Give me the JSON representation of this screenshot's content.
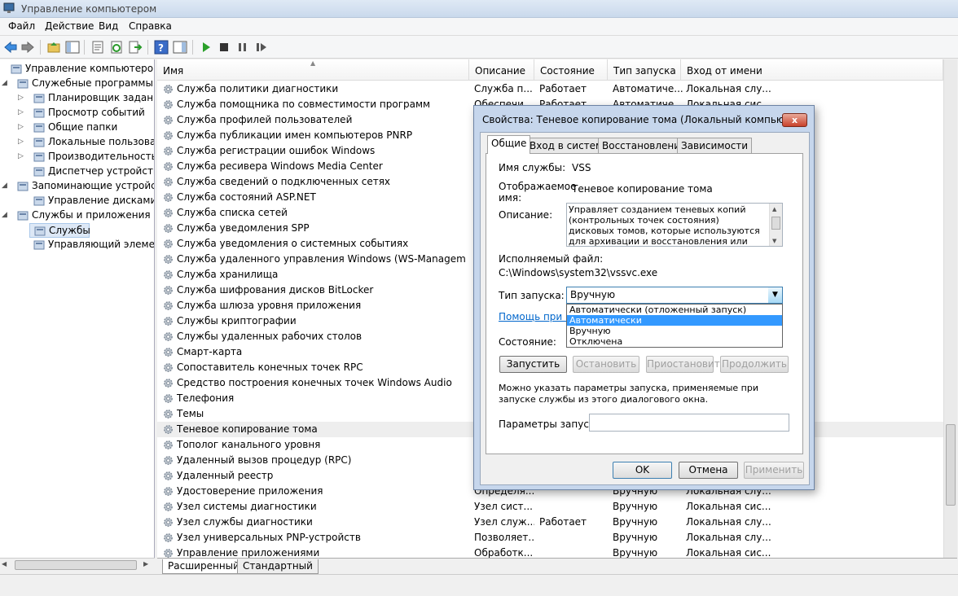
{
  "window": {
    "title": "Управление компьютером"
  },
  "menu": [
    "Файл",
    "Действие",
    "Вид",
    "Справка"
  ],
  "tree": {
    "items": [
      {
        "label": "Управление компьютером (л",
        "indent": 0,
        "arrow": ""
      },
      {
        "label": "Служебные программы",
        "indent": 1,
        "arrow": "◢"
      },
      {
        "label": "Планировщик заданий",
        "indent": 2,
        "arrow": "▷"
      },
      {
        "label": "Просмотр событий",
        "indent": 2,
        "arrow": "▷"
      },
      {
        "label": "Общие папки",
        "indent": 2,
        "arrow": "▷"
      },
      {
        "label": "Локальные пользовате",
        "indent": 2,
        "arrow": "▷"
      },
      {
        "label": "Производительность",
        "indent": 2,
        "arrow": "▷"
      },
      {
        "label": "Диспетчер устройств",
        "indent": 2,
        "arrow": ""
      },
      {
        "label": "Запоминающие устройст",
        "indent": 1,
        "arrow": "◢"
      },
      {
        "label": "Управление дисками",
        "indent": 2,
        "arrow": ""
      },
      {
        "label": "Службы и приложения",
        "indent": 1,
        "arrow": "◢"
      },
      {
        "label": "Службы",
        "indent": 2,
        "arrow": "",
        "selected": true
      },
      {
        "label": "Управляющий элемен",
        "indent": 2,
        "arrow": ""
      }
    ]
  },
  "list": {
    "columns": [
      "Имя",
      "Описание",
      "Состояние",
      "Тип запуска",
      "Вход от имени"
    ],
    "rows": [
      [
        "Служба политики диагностики",
        "Служба п...",
        "Работает",
        "Автоматиче...",
        "Локальная слу..."
      ],
      [
        "Служба помощника по совместимости программ",
        "Обеспечи...",
        "Работает",
        "Автоматиче...",
        "Локальная сис..."
      ],
      [
        "Служба профилей пользователей",
        "",
        "",
        "",
        ""
      ],
      [
        "Служба публикации имен компьютеров PNRP",
        "",
        "",
        "",
        ""
      ],
      [
        "Служба регистрации ошибок Windows",
        "",
        "",
        "",
        ""
      ],
      [
        "Служба ресивера Windows Media Center",
        "",
        "",
        "",
        ""
      ],
      [
        "Служба сведений о подключенных сетях",
        "",
        "",
        "",
        ""
      ],
      [
        "Служба состояний ASP.NET",
        "",
        "",
        "",
        ""
      ],
      [
        "Служба списка сетей",
        "",
        "",
        "",
        ""
      ],
      [
        "Служба уведомления SPP",
        "",
        "",
        "",
        ""
      ],
      [
        "Служба уведомления о системных событиях",
        "",
        "",
        "",
        ""
      ],
      [
        "Служба удаленного управления Windows (WS-Management)",
        "",
        "",
        "",
        ""
      ],
      [
        "Служба хранилища",
        "",
        "",
        "",
        ""
      ],
      [
        "Служба шифрования дисков BitLocker",
        "",
        "",
        "",
        ""
      ],
      [
        "Служба шлюза уровня приложения",
        "",
        "",
        "",
        ""
      ],
      [
        "Службы криптографии",
        "",
        "",
        "",
        ""
      ],
      [
        "Службы удаленных рабочих столов",
        "",
        "",
        "",
        ""
      ],
      [
        "Смарт-карта",
        "",
        "",
        "",
        ""
      ],
      [
        "Сопоставитель конечных точек RPC",
        "",
        "",
        "",
        ""
      ],
      [
        "Средство построения конечных точек Windows Audio",
        "",
        "",
        "",
        ""
      ],
      [
        "Телефония",
        "",
        "",
        "",
        ""
      ],
      [
        "Темы",
        "",
        "",
        "",
        ""
      ],
      [
        "Теневое копирование тома",
        "",
        "",
        "",
        ""
      ],
      [
        "Тополог канального уровня",
        "",
        "",
        "",
        ""
      ],
      [
        "Удаленный вызов процедур (RPC)",
        "",
        "",
        "",
        ""
      ],
      [
        "Удаленный реестр",
        "",
        "",
        "",
        ""
      ],
      [
        "Удостоверение приложения",
        "Определя...",
        "",
        "Вручную",
        "Локальная слу..."
      ],
      [
        "Узел системы диагностики",
        "Узел сист...",
        "",
        "Вручную",
        "Локальная сис..."
      ],
      [
        "Узел службы диагностики",
        "Узел служ...",
        "Работает",
        "Вручную",
        "Локальная слу..."
      ],
      [
        "Узел универсальных PNP-устройств",
        "Позволяет...",
        "",
        "Вручную",
        "Локальная слу..."
      ],
      [
        "Управление приложениями",
        "Обработк...",
        "",
        "Вручную",
        "Локальная сис..."
      ]
    ],
    "selected_row": 22
  },
  "bottom_tabs": [
    "Расширенный",
    "Стандартный"
  ],
  "dialog": {
    "title": "Свойства: Теневое копирование тома (Локальный компьютер)",
    "close": "x",
    "tabs": [
      "Общие",
      "Вход в систему",
      "Восстановление",
      "Зависимости"
    ],
    "service_name_label": "Имя службы:",
    "service_name": "VSS",
    "display_name_label_1": "Отображаемое",
    "display_name_label_2": "имя:",
    "display_name": "Теневое копирование тома",
    "description_label": "Описание:",
    "description": "Управляет созданием теневых копий (контрольных точек состояния) дисковых томов, которые используются для архивации и восстановления или для иных целей. Если эта",
    "exe_label": "Исполняемый файл:",
    "exe_path": "C:\\Windows\\system32\\vssvc.exe",
    "startup_label": "Тип запуска:",
    "startup_value": "Вручную",
    "startup_options": [
      "Автоматически (отложенный запуск)",
      "Автоматически",
      "Вручную",
      "Отключена"
    ],
    "startup_highlighted": 1,
    "help_link": "Помощь при наст",
    "state_label": "Состояние:",
    "buttons": [
      "Запустить",
      "Остановить",
      "Приостановить",
      "Продолжить"
    ],
    "hint": "Можно указать параметры запуска, применяемые при запуске службы из этого диалогового окна.",
    "params_label": "Параметры запуска:",
    "params_value": "",
    "ok": "OK",
    "cancel": "Отмена",
    "apply": "Применить"
  }
}
